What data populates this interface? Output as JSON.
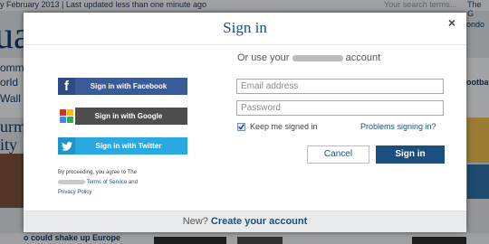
{
  "background": {
    "date_text": "y February 2013 | Last updated less than one minute ago",
    "search_placeholder": "Your search terms...",
    "top_right_text": "The G",
    "brand_fragment": "ua",
    "left_fragments": [
      "omme",
      "orld",
      "Wall"
    ],
    "left_big_fragments": [
      "urm",
      "ity"
    ],
    "right_fragments": [
      "ondo",
      "ootba"
    ],
    "bottom_headline": "o could shake up Europe"
  },
  "modal": {
    "title": "Sign in",
    "close_glyph": "×",
    "social": {
      "facebook_label": "Sign in with Facebook",
      "google_label": "Sign in with Google",
      "twitter_label": "Sign in with Twitter"
    },
    "terms": {
      "prefix": "By proceeding, you agree to The",
      "terms_link": "Terms of Service",
      "and": "and",
      "privacy_link": "Privacy Policy"
    },
    "form": {
      "or_use_prefix": "Or use your",
      "or_use_suffix": "account",
      "email_placeholder": "Email address",
      "password_placeholder": "Password",
      "keep_signed_in_label": "Keep me signed in",
      "keep_signed_in_checked": true,
      "problems_link": "Problems signing in?",
      "cancel_label": "Cancel",
      "signin_label": "Sign in"
    },
    "footer": {
      "prefix": "New?",
      "create_link": "Create your account"
    }
  },
  "colors": {
    "brand_blue": "#1b4f7f",
    "facebook": "#3b5a98",
    "google": "#4d4d4d",
    "twitter": "#29a9e1"
  }
}
